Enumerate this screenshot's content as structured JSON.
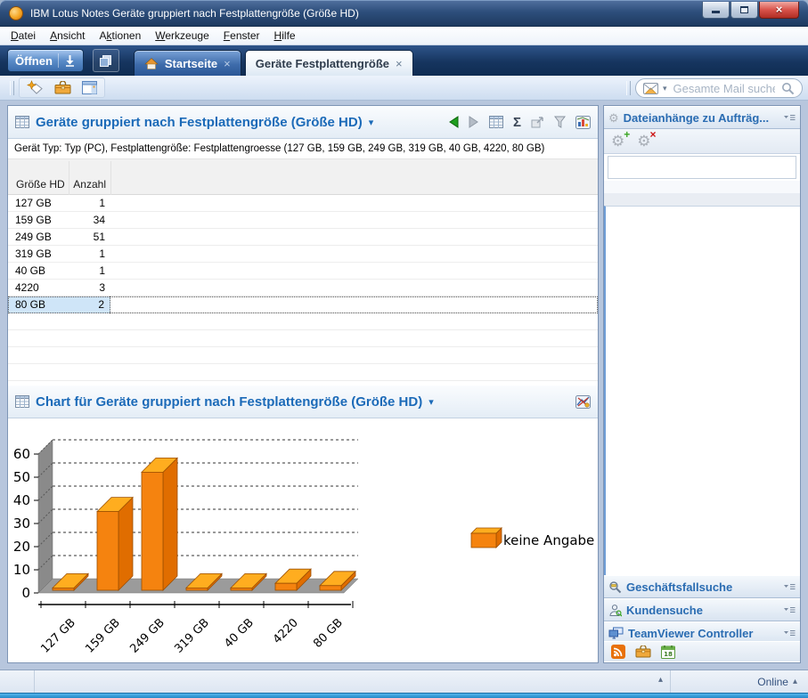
{
  "window": {
    "title": "IBM Lotus Notes Geräte gruppiert nach Festplattengröße (Größe HD)"
  },
  "menu": {
    "items": [
      {
        "label": "Datei",
        "u": 0
      },
      {
        "label": "Ansicht",
        "u": 0
      },
      {
        "label": "Aktionen",
        "u": 1
      },
      {
        "label": "Werkzeuge",
        "u": 0
      },
      {
        "label": "Fenster",
        "u": 0
      },
      {
        "label": "Hilfe",
        "u": 0
      }
    ]
  },
  "tabbar": {
    "open_label": "Öffnen",
    "tabs": [
      {
        "label": "Startseite",
        "active": false
      },
      {
        "label": "Geräte Festplattengröße",
        "active": true
      }
    ]
  },
  "toolbar": {
    "search_placeholder": "Gesamte Mail suchen"
  },
  "view": {
    "title": "Geräte gruppiert nach Festplattengröße (Größe HD)",
    "subtitle": "Gerät Typ: Typ (PC), Festplattengröße: Festplattengroesse (127 GB, 159 GB, 249 GB, 319 GB, 40 GB, 4220, 80 GB)",
    "sum_icon_glyph": "Σ",
    "table": {
      "columns": [
        "Größe HD",
        "Anzahl"
      ],
      "rows": [
        [
          "127 GB",
          "1"
        ],
        [
          "159 GB",
          "34"
        ],
        [
          "249 GB",
          "51"
        ],
        [
          "319 GB",
          "1"
        ],
        [
          "40 GB",
          "1"
        ],
        [
          "4220",
          "3"
        ],
        [
          "80 GB",
          "2"
        ]
      ],
      "selected_row": 6
    }
  },
  "chart_section": {
    "title": "Chart für Geräte gruppiert nach Festplattengröße (Größe HD)"
  },
  "chart_data": {
    "type": "bar",
    "style": "3d",
    "title": "Chart für Geräte gruppiert nach Festplattengröße (Größe HD)",
    "categories": [
      "127 GB",
      "159 GB",
      "249 GB",
      "319 GB",
      "40 GB",
      "4220",
      "80 GB"
    ],
    "values": [
      1,
      34,
      51,
      1,
      1,
      3,
      2
    ],
    "series": [
      {
        "name": "keine Angabe",
        "values": [
          1,
          34,
          51,
          1,
          1,
          3,
          2
        ]
      }
    ],
    "legend": [
      "keine Angabe"
    ],
    "legend_position": "right",
    "xlabel": "",
    "ylabel": "",
    "ylim": [
      0,
      60
    ],
    "yticks": [
      0,
      10,
      20,
      30,
      40,
      50,
      60
    ],
    "grid": true,
    "bar_color": "#F5830F",
    "bar_top_color": "#FFAD1F",
    "bar_side_color": "#E06D00"
  },
  "sidebar": {
    "panels": [
      {
        "title": "Dateianhänge zu Aufträg..."
      },
      {
        "title": "Geschäftsfallsuche"
      },
      {
        "title": "Kundensuche"
      },
      {
        "title": "TeamViewer Controller"
      }
    ],
    "calendar_day": "18"
  },
  "statusbar": {
    "online_label": "Online"
  }
}
